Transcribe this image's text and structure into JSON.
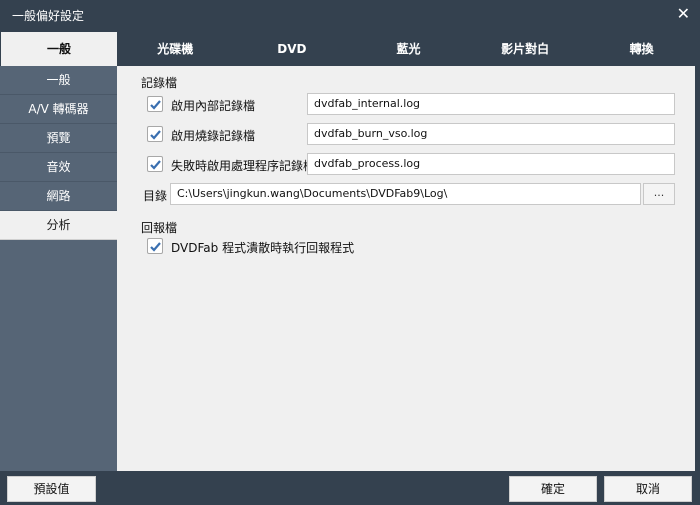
{
  "window": {
    "title": "一般偏好設定"
  },
  "tabs": {
    "current": "一般",
    "items": [
      "光碟機",
      "DVD",
      "藍光",
      "影片對白",
      "轉換"
    ]
  },
  "sidebar": {
    "items": [
      {
        "label": "一般"
      },
      {
        "label": "A/V 轉碼器"
      },
      {
        "label": "預覽"
      },
      {
        "label": "音效"
      },
      {
        "label": "網路"
      },
      {
        "label": "分析"
      }
    ],
    "active": "分析"
  },
  "log_section": {
    "title": "記錄檔",
    "options": [
      {
        "label": "啟用內部記錄檔",
        "checked": true,
        "value": "dvdfab_internal.log"
      },
      {
        "label": "啟用燒錄記錄檔",
        "checked": true,
        "value": "dvdfab_burn_vso.log"
      },
      {
        "label": "失敗時啟用處理程序記錄檔",
        "checked": true,
        "value": "dvdfab_process.log"
      }
    ],
    "directory": {
      "label": "目錄",
      "value": "C:\\Users\\jingkun.wang\\Documents\\DVDFab9\\Log\\",
      "browse_label": "..."
    }
  },
  "report_section": {
    "title": "回報檔",
    "option": {
      "label": "DVDFab 程式潰散時執行回報程式",
      "checked": true
    }
  },
  "buttons": {
    "defaults": "預設值",
    "ok": "確定",
    "cancel": "取消"
  },
  "colors": {
    "frame": "#34414f",
    "sidebar": "#566576",
    "content": "#f0f0f0",
    "check": "#3a6fb0"
  }
}
